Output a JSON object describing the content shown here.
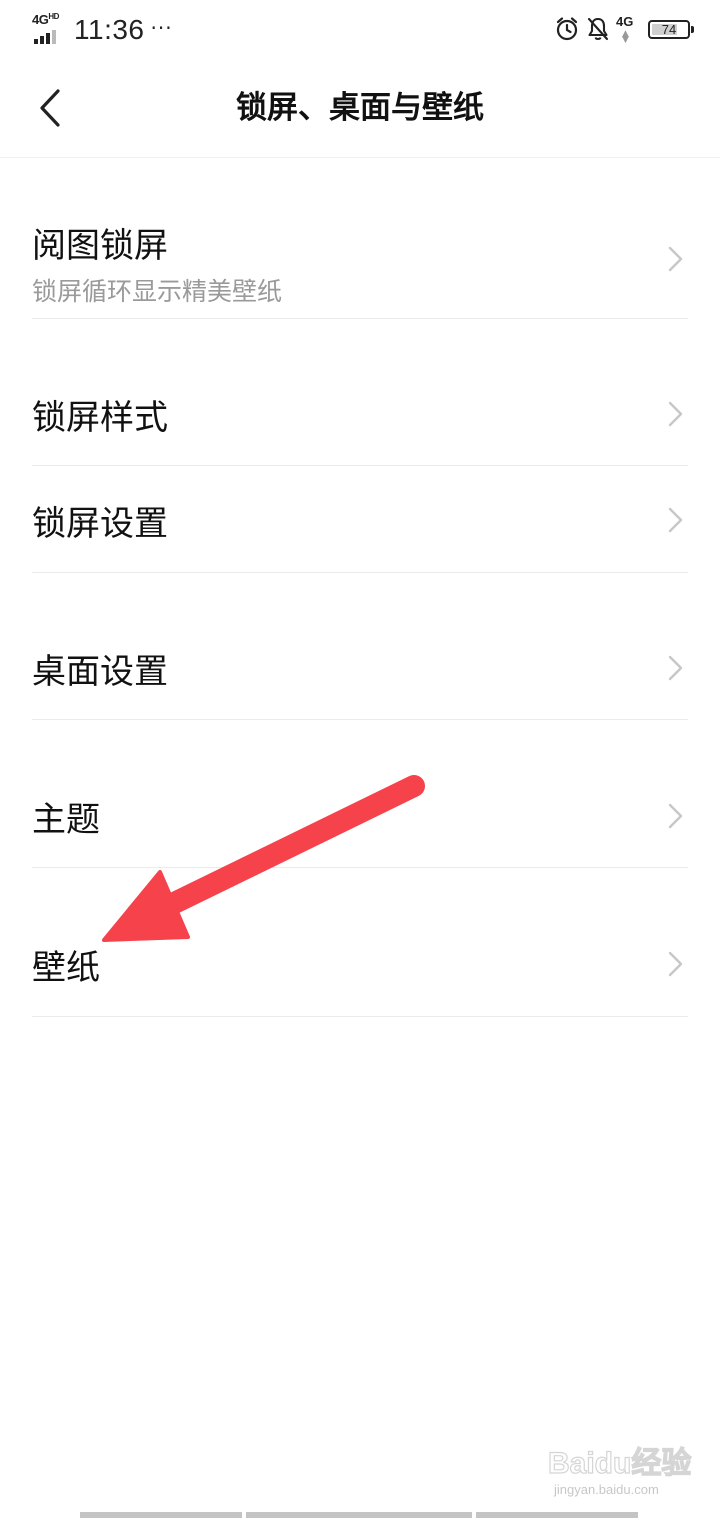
{
  "status_bar": {
    "network_left": "4G",
    "network_left_suffix": "HD",
    "time": "11:36",
    "more": "···",
    "network_right": "4G",
    "battery_level": "74",
    "battery_fraction": 0.74,
    "icons": [
      "signal-icon",
      "alarm-icon",
      "notifications-off-icon",
      "battery-icon"
    ]
  },
  "header": {
    "title": "锁屏、桌面与壁纸",
    "back_icon": "chevron-left-icon"
  },
  "settings": {
    "items": [
      {
        "label": "阅图锁屏",
        "subtitle": "锁屏循环显示精美壁纸"
      },
      {
        "label": "锁屏样式"
      },
      {
        "label": "锁屏设置"
      },
      {
        "label": "桌面设置"
      },
      {
        "label": "主题"
      },
      {
        "label": "壁纸"
      }
    ],
    "row_icon": "chevron-right-icon"
  },
  "annotation": {
    "arrow_color": "#f5424b",
    "target": "壁纸"
  },
  "watermark": {
    "main": "Baidu经验",
    "sub": "jingyan.baidu.com"
  }
}
